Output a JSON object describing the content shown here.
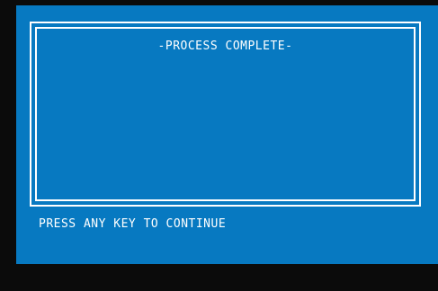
{
  "dialog": {
    "title": "-PROCESS COMPLETE-"
  },
  "prompt": {
    "text": "PRESS ANY KEY TO CONTINUE"
  },
  "colors": {
    "screen_background": "#0779c1",
    "text": "#ffffff",
    "frame": "#ffffff",
    "outside": "#0b0b0b"
  }
}
